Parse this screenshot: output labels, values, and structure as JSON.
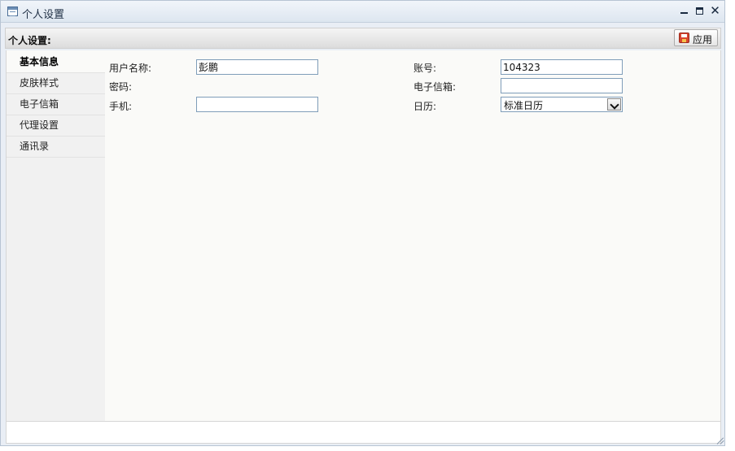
{
  "window": {
    "title": "个人设置",
    "icon": "table-icon",
    "controls": [
      "minimize-icon",
      "maximize-icon",
      "close-icon"
    ]
  },
  "toolbar": {
    "title": "个人设置:",
    "apply_label": "应用",
    "apply_icon": "save-icon"
  },
  "sidebar": {
    "items": [
      {
        "label": "基本信息",
        "active": true
      },
      {
        "label": "皮肤样式",
        "active": false
      },
      {
        "label": "电子信箱",
        "active": false
      },
      {
        "label": "代理设置",
        "active": false
      },
      {
        "label": "通讯录",
        "active": false
      }
    ]
  },
  "form": {
    "username": {
      "label": "用户名称:",
      "value": "彭鹏"
    },
    "password": {
      "label": "密码:"
    },
    "mobile": {
      "label": "手机:",
      "value": ""
    },
    "account": {
      "label": "账号:",
      "value": "104323"
    },
    "email": {
      "label": "电子信箱:",
      "value": ""
    },
    "calendar": {
      "label": "日历:",
      "selected": "标准日历"
    }
  },
  "colors": {
    "titlebar": "#dde6f0",
    "content_bg": "#fafaf8",
    "sidebar_bg": "#f1f1f1",
    "input_border": "#7f9db9"
  }
}
